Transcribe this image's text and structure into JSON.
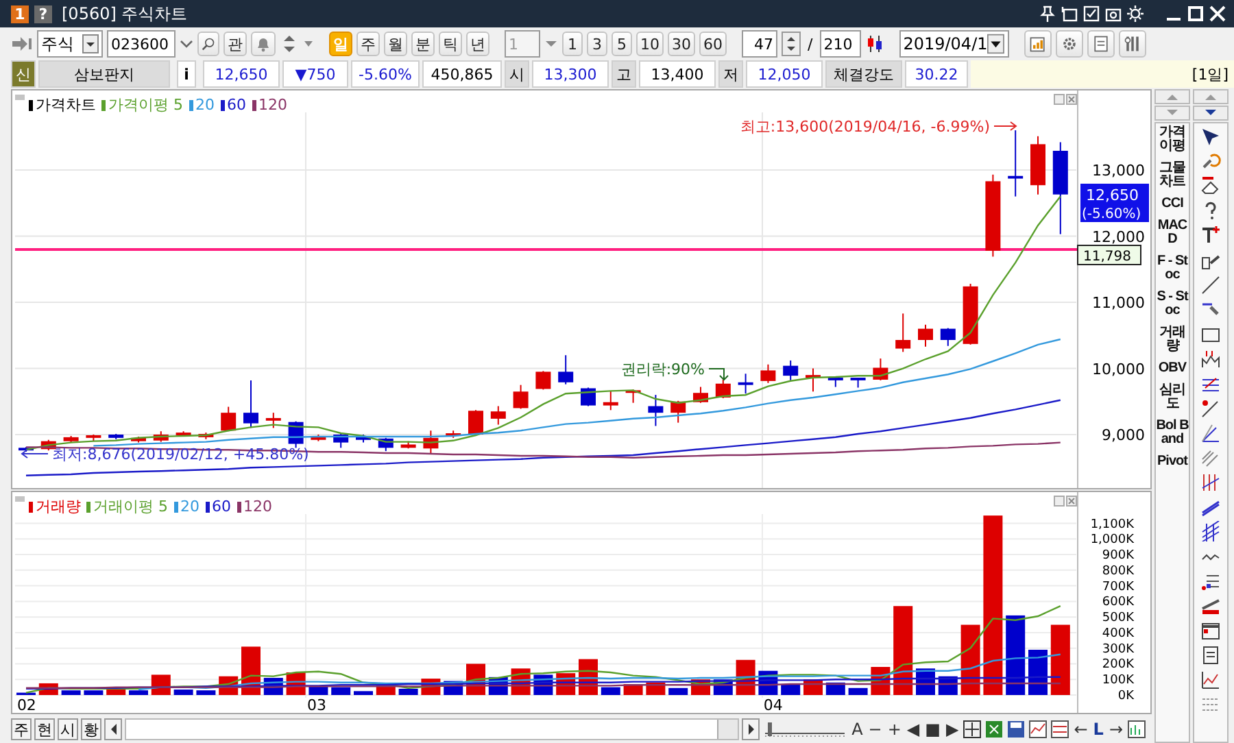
{
  "window": {
    "number_badge": "1",
    "help_badge": "?",
    "title": "[0560] 주식차트"
  },
  "toolbar": {
    "market": "주식",
    "code": "023600",
    "watch_button": "관",
    "periods": [
      {
        "label": "일",
        "selected": true
      },
      {
        "label": "주",
        "selected": false
      },
      {
        "label": "월",
        "selected": false
      },
      {
        "label": "분",
        "selected": false
      },
      {
        "label": "틱",
        "selected": false
      },
      {
        "label": "년",
        "selected": false
      }
    ],
    "interval": "1",
    "quick_intervals": [
      "1",
      "3",
      "5",
      "10",
      "30",
      "60"
    ],
    "count": "47",
    "separator": "/",
    "total": "210",
    "date": "2019/04/1"
  },
  "info": {
    "badge": "신",
    "name": "삼보판지",
    "info_button": "i",
    "quotes": [
      {
        "value": "12,650",
        "color": "#1a1ad0"
      },
      {
        "value": "▼750",
        "color": "#1a1ad0"
      },
      {
        "value": "-5.60%",
        "color": "#1a1ad0"
      },
      {
        "value": "450,865",
        "color": "#000000"
      }
    ],
    "fields": [
      {
        "label": "시",
        "value": "13,300",
        "color": "#1a1ad0"
      },
      {
        "label": "고",
        "value": "13,400",
        "color": "#000000"
      },
      {
        "label": "저",
        "value": "12,050",
        "color": "#1a1ad0"
      },
      {
        "label": "체결강도",
        "value": "30.22",
        "color": "#1a1ad0"
      }
    ],
    "period_tag": "[1일]"
  },
  "price_chart": {
    "legend_title": {
      "label": "가격차트",
      "color": "#000000"
    },
    "current_price": "12,650",
    "current_rate": "(-5.60%)",
    "high_note": "최고:13,600(2019/04/16, -6.99%)",
    "low_note": "최저:8,676(2019/02/12, +45.80%)",
    "event_note": "권리락:90%",
    "chart_data": {
      "type": "candlestick",
      "grid": true,
      "ylim": [
        8192,
        14202
      ],
      "yticks": [
        {
          "value": 13000,
          "label": "13,000"
        },
        {
          "value": 12000,
          "label": "12,000"
        },
        {
          "value": 11000,
          "label": "11,000"
        },
        {
          "value": 10000,
          "label": "10,000"
        },
        {
          "value": 9000,
          "label": "9,000"
        }
      ],
      "ref_lines": [
        {
          "axis": "y",
          "value": 11798,
          "label": "11,798",
          "color": "#ff1f80"
        }
      ],
      "ohlc": [
        [
          8800,
          8810,
          8740,
          8760
        ],
        [
          8780,
          8920,
          8760,
          8900
        ],
        [
          8900,
          8980,
          8880,
          8960
        ],
        [
          8950,
          9000,
          8900,
          8990
        ],
        [
          9000,
          9010,
          8930,
          8950
        ],
        [
          8900,
          8970,
          8880,
          8950
        ],
        [
          8910,
          9050,
          8890,
          9000
        ],
        [
          8990,
          9050,
          8980,
          9030
        ],
        [
          8960,
          9030,
          8930,
          9010
        ],
        [
          9060,
          9420,
          9050,
          9330
        ],
        [
          9330,
          9820,
          9100,
          9170
        ],
        [
          9210,
          9330,
          9100,
          9250
        ],
        [
          9190,
          9200,
          8800,
          8860
        ],
        [
          8920,
          9000,
          8900,
          8980
        ],
        [
          9000,
          9010,
          8800,
          8880
        ],
        [
          8960,
          9000,
          8880,
          8920
        ],
        [
          8940,
          8950,
          8750,
          8800
        ],
        [
          8800,
          8900,
          8790,
          8850
        ],
        [
          8790,
          9060,
          8700,
          8950
        ],
        [
          8980,
          9060,
          8950,
          9020
        ],
        [
          9000,
          9370,
          8990,
          9360
        ],
        [
          9240,
          9430,
          9150,
          9350
        ],
        [
          9400,
          9750,
          9390,
          9650
        ],
        [
          9690,
          9960,
          9680,
          9950
        ],
        [
          9950,
          10200,
          9760,
          9790
        ],
        [
          9700,
          9710,
          9430,
          9440
        ],
        [
          9440,
          9660,
          9370,
          9490
        ],
        [
          9630,
          9680,
          9480,
          9670
        ],
        [
          9430,
          9600,
          9130,
          9330
        ],
        [
          9330,
          9510,
          9180,
          9500
        ],
        [
          9490,
          9720,
          9480,
          9630
        ],
        [
          9560,
          9830,
          9550,
          9770
        ],
        [
          9790,
          9920,
          9620,
          9750
        ],
        [
          9810,
          10060,
          9780,
          9970
        ],
        [
          10040,
          10120,
          9820,
          9890
        ],
        [
          9860,
          10000,
          9650,
          9900
        ],
        [
          9860,
          9880,
          9720,
          9820
        ],
        [
          9860,
          9860,
          9710,
          9820
        ],
        [
          9830,
          10150,
          9820,
          10010
        ],
        [
          10300,
          10830,
          10250,
          10430
        ],
        [
          10430,
          10660,
          10330,
          10600
        ],
        [
          10600,
          10610,
          10340,
          10430
        ],
        [
          10370,
          11280,
          10360,
          11240
        ],
        [
          11780,
          12930,
          11690,
          12830
        ],
        [
          12910,
          13600,
          12600,
          12870
        ],
        [
          12770,
          13510,
          12630,
          13390
        ],
        [
          13290,
          13420,
          12030,
          12630
        ]
      ],
      "series": [
        {
          "name": "가격이평 5",
          "type": "line",
          "color": "#5aa02c",
          "values": [
            8770,
            8840,
            8880,
            8900,
            8910,
            8950,
            8970,
            8980,
            8990,
            9060,
            9110,
            9150,
            9120,
            9110,
            9020,
            8980,
            8890,
            8890,
            8880,
            8910,
            8990,
            9100,
            9260,
            9460,
            9620,
            9640,
            9660,
            9670,
            9540,
            9480,
            9520,
            9580,
            9600,
            9730,
            9810,
            9860,
            9870,
            9890,
            9890,
            10000,
            10140,
            10260,
            10540,
            11110,
            11600,
            12160,
            12600
          ]
        },
        {
          "name": "20",
          "type": "line",
          "color": "#3399dd",
          "values": [
            null,
            null,
            null,
            8830,
            8840,
            8860,
            8870,
            8880,
            8890,
            8920,
            8940,
            8960,
            8960,
            8970,
            8970,
            8970,
            8970,
            8970,
            8970,
            8980,
            9010,
            9030,
            9060,
            9110,
            9160,
            9180,
            9210,
            9240,
            9260,
            9290,
            9320,
            9360,
            9410,
            9470,
            9520,
            9560,
            9610,
            9660,
            9710,
            9790,
            9850,
            9910,
            9990,
            10110,
            10230,
            10360,
            10440
          ]
        },
        {
          "name": "60",
          "type": "line",
          "color": "#1a1ac8",
          "values": [
            8380,
            8390,
            8400,
            8420,
            8430,
            8440,
            8450,
            8460,
            8470,
            8480,
            8500,
            8510,
            8520,
            8530,
            8540,
            8550,
            8560,
            8580,
            8590,
            8600,
            8610,
            8620,
            8630,
            8650,
            8660,
            8670,
            8680,
            8690,
            8720,
            8750,
            8780,
            8810,
            8840,
            8870,
            8900,
            8930,
            8960,
            9010,
            9050,
            9100,
            9150,
            9200,
            9250,
            9320,
            9380,
            9450,
            9520
          ]
        },
        {
          "name": "120",
          "type": "line",
          "color": "#8a3466",
          "values": [
            8810,
            8810,
            8800,
            8800,
            8790,
            8790,
            8780,
            8780,
            8770,
            8770,
            8760,
            8760,
            8750,
            8740,
            8740,
            8730,
            8720,
            8720,
            8710,
            8700,
            8700,
            8690,
            8680,
            8680,
            8670,
            8660,
            8660,
            8650,
            8660,
            8670,
            8680,
            8690,
            8690,
            8700,
            8710,
            8720,
            8730,
            8750,
            8760,
            8770,
            8790,
            8800,
            8820,
            8830,
            8850,
            8860,
            8880
          ]
        }
      ]
    }
  },
  "volume_chart": {
    "month_labels": [
      "02",
      "03",
      "04"
    ],
    "chart_data": {
      "type": "bar",
      "grid": true,
      "ylim": [
        0,
        1300
      ],
      "yticks": [
        {
          "value": 1100,
          "label": "1,100K"
        },
        {
          "value": 1000,
          "label": "1,000K"
        },
        {
          "value": 900,
          "label": "900K"
        },
        {
          "value": 800,
          "label": "800K"
        },
        {
          "value": 700,
          "label": "700K"
        },
        {
          "value": 600,
          "label": "600K"
        },
        {
          "value": 500,
          "label": "500K"
        },
        {
          "value": 400,
          "label": "400K"
        },
        {
          "value": 300,
          "label": "300K"
        },
        {
          "value": 200,
          "label": "200K"
        },
        {
          "value": 100,
          "label": "100K"
        },
        {
          "value": 0,
          "label": "0K"
        }
      ],
      "series": [
        {
          "name": "거래량",
          "type": "bar",
          "color": "#dd0000",
          "values": [
            null,
            75,
            null,
            null,
            40,
            null,
            130,
            null,
            null,
            120,
            310,
            null,
            145,
            null,
            null,
            null,
            60,
            null,
            105,
            null,
            200,
            null,
            170,
            null,
            140,
            230,
            null,
            70,
            80,
            null,
            100,
            null,
            225,
            null,
            null,
            100,
            null,
            null,
            180,
            570,
            null,
            null,
            450,
            1150,
            null,
            null,
            450
          ]
        },
        {
          "type": "bar",
          "color": "#0000cc",
          "values": [
            15,
            null,
            30,
            30,
            null,
            30,
            null,
            35,
            30,
            null,
            null,
            110,
            null,
            60,
            50,
            25,
            null,
            40,
            null,
            90,
            null,
            115,
            null,
            130,
            null,
            null,
            50,
            null,
            null,
            45,
            null,
            100,
            null,
            155,
            70,
            null,
            80,
            45,
            null,
            null,
            170,
            120,
            null,
            null,
            510,
            290,
            null
          ]
        },
        {
          "name": "거래이평 5",
          "type": "line",
          "color": "#5aa02c",
          "values": [
            15,
            45,
            40,
            40,
            40,
            40,
            50,
            55,
            55,
            70,
            125,
            120,
            145,
            150,
            135,
            80,
            70,
            45,
            55,
            65,
            100,
            110,
            135,
            140,
            150,
            155,
            145,
            125,
            115,
            95,
            70,
            80,
            110,
            125,
            130,
            130,
            125,
            90,
            95,
            195,
            210,
            215,
            300,
            490,
            480,
            505,
            570
          ]
        },
        {
          "name": "20",
          "type": "line",
          "color": "#3399dd",
          "values": [
            null,
            null,
            null,
            null,
            null,
            35,
            50,
            50,
            45,
            55,
            75,
            80,
            85,
            85,
            80,
            80,
            75,
            75,
            75,
            80,
            85,
            90,
            95,
            100,
            105,
            110,
            105,
            110,
            110,
            105,
            110,
            110,
            115,
            120,
            120,
            120,
            125,
            125,
            125,
            150,
            155,
            155,
            170,
            220,
            235,
            240,
            260
          ]
        },
        {
          "name": "60",
          "type": "line",
          "color": "#1a1ac8",
          "values": [
            40,
            40,
            45,
            45,
            45,
            50,
            50,
            50,
            55,
            55,
            55,
            60,
            60,
            60,
            65,
            65,
            65,
            70,
            70,
            70,
            75,
            75,
            75,
            80,
            80,
            80,
            80,
            85,
            85,
            85,
            90,
            90,
            90,
            95,
            95,
            95,
            100,
            100,
            100,
            105,
            105,
            105,
            110,
            110,
            110,
            115,
            115
          ]
        },
        {
          "name": "120",
          "type": "line",
          "color": "#8a3466",
          "values": [
            45,
            45,
            45,
            45,
            50,
            50,
            50,
            50,
            50,
            50,
            50,
            50,
            55,
            55,
            55,
            55,
            55,
            55,
            55,
            60,
            60,
            60,
            60,
            60,
            60,
            60,
            60,
            65,
            65,
            65,
            65,
            65,
            65,
            65,
            70,
            70,
            70,
            70,
            70,
            70,
            70,
            70,
            75,
            75,
            75,
            75,
            75
          ]
        }
      ]
    }
  },
  "bottom": {
    "tabs": [
      "주",
      "현",
      "시",
      "황"
    ],
    "controls": [
      "A",
      "−",
      "+",
      "◀",
      "■",
      "▶"
    ],
    "nav": [
      "←",
      "L",
      "→"
    ]
  },
  "indicators": [
    "가격이평",
    "그물차트",
    "CCI",
    "MACD",
    "F - Stoc",
    "S - Stoc",
    "거래량",
    "OBV",
    "심리도",
    "Bol Band",
    "Pivot"
  ]
}
